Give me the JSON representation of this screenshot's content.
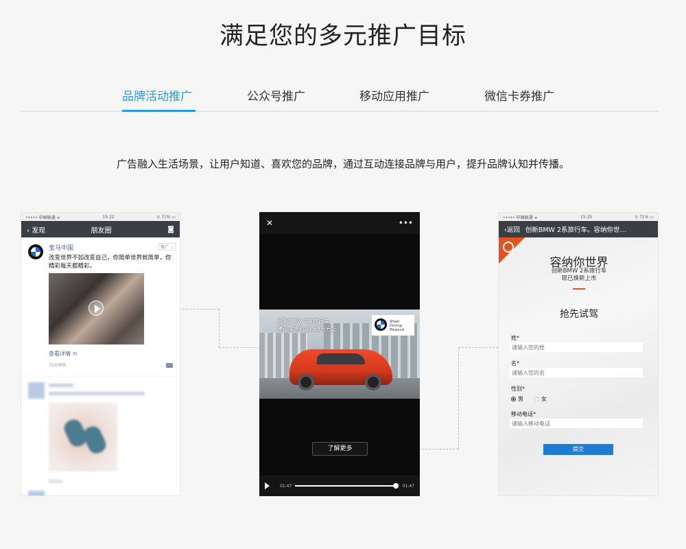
{
  "title": "满足您的多元推广目标",
  "tabs": [
    {
      "label": "品牌活动推广",
      "active": true
    },
    {
      "label": "公众号推广",
      "active": false
    },
    {
      "label": "移动应用推广",
      "active": false
    },
    {
      "label": "微信卡券推广",
      "active": false
    }
  ],
  "description": "广告融入生活场景，让用户知道、喜欢您的品牌，通过互动连接品牌与用户，提升品牌认知并传播。",
  "colors": {
    "accent": "#2a9bd8",
    "bmw_red": "#e45223",
    "submit_blue": "#1d7dd3"
  },
  "phone_moments": {
    "status": {
      "carrier": "••••• 中国联通 ᯤ",
      "time": "15:22",
      "battery": "⊙ 71% ▭"
    },
    "nav": {
      "back": "发现",
      "title": "朋友圈"
    },
    "post": {
      "account": "宝马中国",
      "promo_tag": "推广 ⌄",
      "text": "改变世界不如改变自己，你简单世界就简单，你精彩每天都精彩。",
      "link": "查看详情 ⟲",
      "time": "15分钟前"
    }
  },
  "phone_video": {
    "ad_text": "创新BMW 2系旅行车\n建议零售价23.69万元起",
    "brand_slogan": "Sheer\nDriving\nPleasure",
    "cta": "了解更多",
    "time_current": "01:47",
    "time_total": "01:47",
    "progress": 0.97
  },
  "phone_form": {
    "status": {
      "carrier": "••••• 中国联通 ᯤ",
      "time": "15:25",
      "battery": "⊙ 71% ▭"
    },
    "nav": {
      "back": "返回",
      "title": "创新BMW 2系旅行车。容纳你世…"
    },
    "headline": "容纳你世界",
    "subhead": "创新BMW 2系旅行车\n现已焕新上市",
    "section": "抢先试驾",
    "fields": {
      "surname_label": "姓*",
      "surname_placeholder": "请输入您的姓",
      "name_label": "名*",
      "name_placeholder": "请输入您的名",
      "gender_label": "性别*",
      "gender_male": "男",
      "gender_female": "女",
      "phone_label": "移动电话*",
      "phone_placeholder": "请输入移动电话"
    },
    "submit": "提交"
  }
}
